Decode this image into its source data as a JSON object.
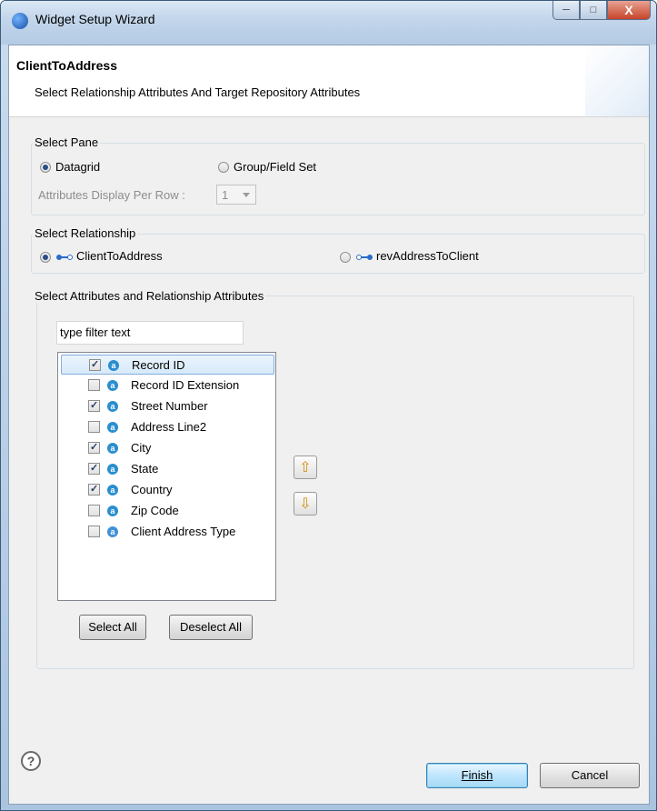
{
  "window": {
    "title": "Widget Setup Wizard",
    "min": "─",
    "max": "□",
    "close": "X"
  },
  "banner": {
    "title": "ClientToAddress",
    "subtitle": "Select Relationship Attributes And Target Repository Attributes"
  },
  "pane": {
    "legend": "Select Pane",
    "options": [
      "Datagrid",
      "Group/Field Set"
    ],
    "selected": "Datagrid",
    "per_row_label": "Attributes Display Per Row :",
    "per_row_value": "1"
  },
  "relationship": {
    "legend": "Select Relationship",
    "options": [
      "ClientToAddress",
      "revAddressToClient"
    ],
    "selected": "ClientToAddress"
  },
  "attributes": {
    "legend": "Select Attributes and Relationship Attributes",
    "filter_placeholder": "type filter text",
    "items": [
      {
        "label": "Record ID",
        "checked": true,
        "icon": "attribute-icon",
        "selected": true
      },
      {
        "label": "Record ID Extension",
        "checked": false,
        "icon": "attribute-icon"
      },
      {
        "label": "Street Number",
        "checked": true,
        "icon": "attribute-icon"
      },
      {
        "label": "Address Line2",
        "checked": false,
        "icon": "attribute-icon"
      },
      {
        "label": "City",
        "checked": true,
        "icon": "attribute-icon"
      },
      {
        "label": "State",
        "checked": true,
        "icon": "attribute-icon"
      },
      {
        "label": "Country",
        "checked": true,
        "icon": "attribute-icon"
      },
      {
        "label": "Zip Code",
        "checked": false,
        "icon": "attribute-icon"
      },
      {
        "label": "Client Address Type",
        "checked": false,
        "icon": "relationship-attribute-icon"
      }
    ],
    "select_all": "Select All",
    "deselect_all": "Deselect All"
  },
  "footer": {
    "help": "?",
    "finish": "Finish",
    "cancel": "Cancel"
  },
  "colors": {
    "accent": "#2a4e86",
    "selection": "#d7eafa",
    "arrow": "#d28d00"
  }
}
